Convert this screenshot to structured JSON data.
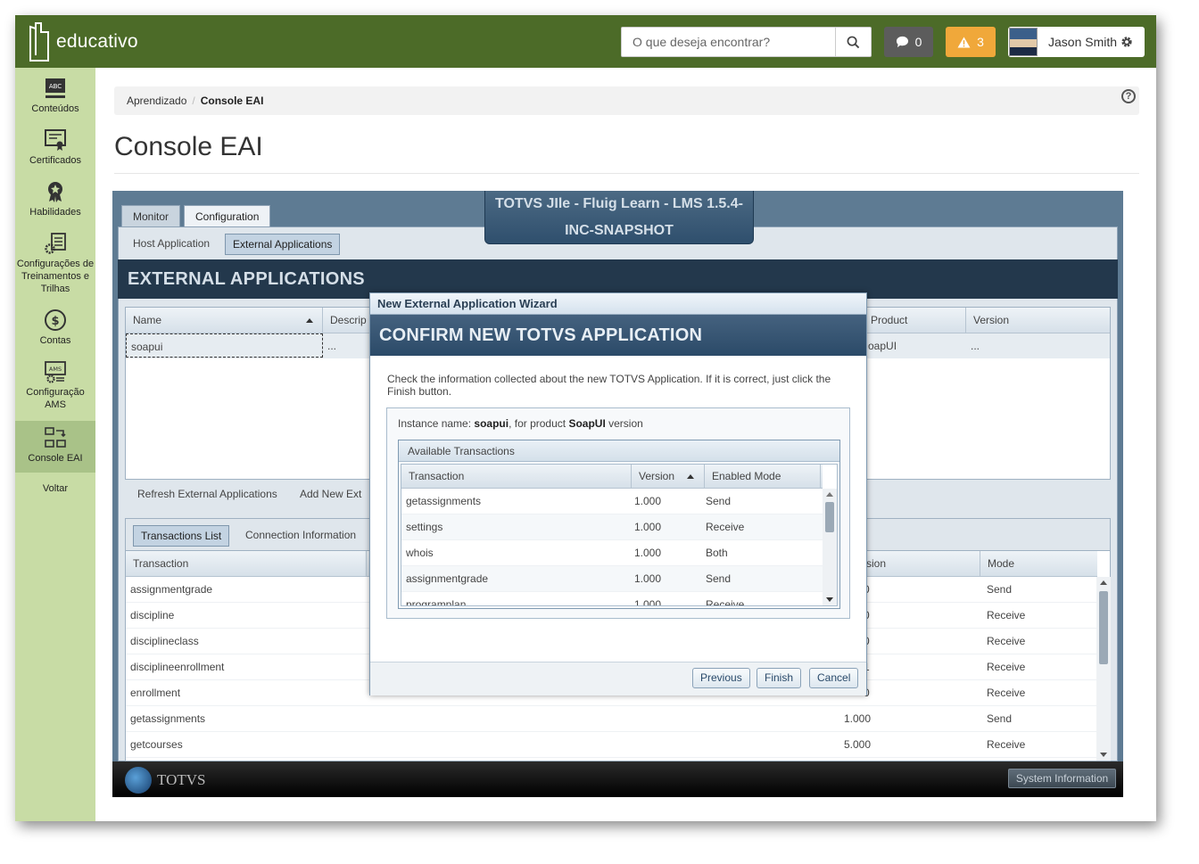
{
  "brand": "educativo",
  "search": {
    "placeholder": "O que deseja encontrar?"
  },
  "badges": {
    "messages": "0",
    "alerts": "3"
  },
  "user": {
    "name": "Jason Smith"
  },
  "sidebar": {
    "items": [
      {
        "label": "Conteúdos"
      },
      {
        "label": "Certificados"
      },
      {
        "label": "Habilidades"
      },
      {
        "label": "Configurações de Treinamentos e Trilhas"
      },
      {
        "label": "Contas"
      },
      {
        "label": "Configuração AMS"
      },
      {
        "label": "Console EAI"
      },
      {
        "label": "Voltar"
      }
    ]
  },
  "breadcrumb": {
    "parent": "Aprendizado",
    "current": "Console EAI"
  },
  "page_title": "Console EAI",
  "app": {
    "banner_line1": "TOTVS JIle - Fluig Learn - LMS 1.5.4-",
    "banner_line2": "INC-SNAPSHOT",
    "tabs": [
      "Monitor",
      "Configuration"
    ],
    "subtabs": [
      "Host Application",
      "External Applications"
    ],
    "section_title": "EXTERNAL APPLICATIONS",
    "ext_grid": {
      "headers": [
        "Name",
        "Descrip",
        "Product",
        "Version"
      ],
      "row": {
        "name": "soapui",
        "desc": "...",
        "product": "oapUI",
        "version": "..."
      }
    },
    "toolbar": {
      "refresh": "Refresh External Applications",
      "add": "Add New Ext"
    },
    "lower_tabs": [
      "Transactions List",
      "Connection Information"
    ],
    "tx_grid": {
      "headers": [
        "Transaction",
        "sion",
        "Mode"
      ],
      "rows": [
        {
          "name": "assignmentgrade",
          "version": "0",
          "mode": "Send"
        },
        {
          "name": "discipline",
          "version": "0",
          "mode": "Receive"
        },
        {
          "name": "disciplineclass",
          "version": "0",
          "mode": "Receive"
        },
        {
          "name": "disciplineenrollment",
          "version": "1",
          "mode": "Receive"
        },
        {
          "name": "enrollment",
          "version": "0",
          "mode": "Receive"
        },
        {
          "name": "getassignments",
          "version": "1.000",
          "mode": "Send"
        },
        {
          "name": "getcourses",
          "version": "5.000",
          "mode": "Receive"
        }
      ]
    },
    "footer": {
      "logo": "TOTVS",
      "system_info": "System Information"
    }
  },
  "modal": {
    "window_title": "New External Application Wizard",
    "heading": "CONFIRM NEW TOTVS APPLICATION",
    "description": "Check the information collected about the new TOTVS Application. If it is correct, just click the Finish button.",
    "info_prefix": "Instance name: ",
    "instance": "soapui",
    "info_mid": ", for product ",
    "product": "SoapUI",
    "info_suffix": " version",
    "panel_title": "Available Transactions",
    "headers": [
      "Transaction",
      "Version",
      "Enabled Mode"
    ],
    "rows": [
      {
        "name": "getassignments",
        "version": "1.000",
        "mode": "Send"
      },
      {
        "name": "settings",
        "version": "1.000",
        "mode": "Receive"
      },
      {
        "name": "whois",
        "version": "1.000",
        "mode": "Both"
      },
      {
        "name": "assignmentgrade",
        "version": "1.000",
        "mode": "Send"
      },
      {
        "name": "programplan",
        "version": "1.000",
        "mode": "Receive"
      }
    ],
    "buttons": {
      "previous": "Previous",
      "finish": "Finish",
      "cancel": "Cancel"
    }
  },
  "colors": {
    "topbar": "#4c6b28",
    "sidebar": "#c8dca5",
    "alert": "#f0a83a",
    "app_header": "#23384c"
  }
}
